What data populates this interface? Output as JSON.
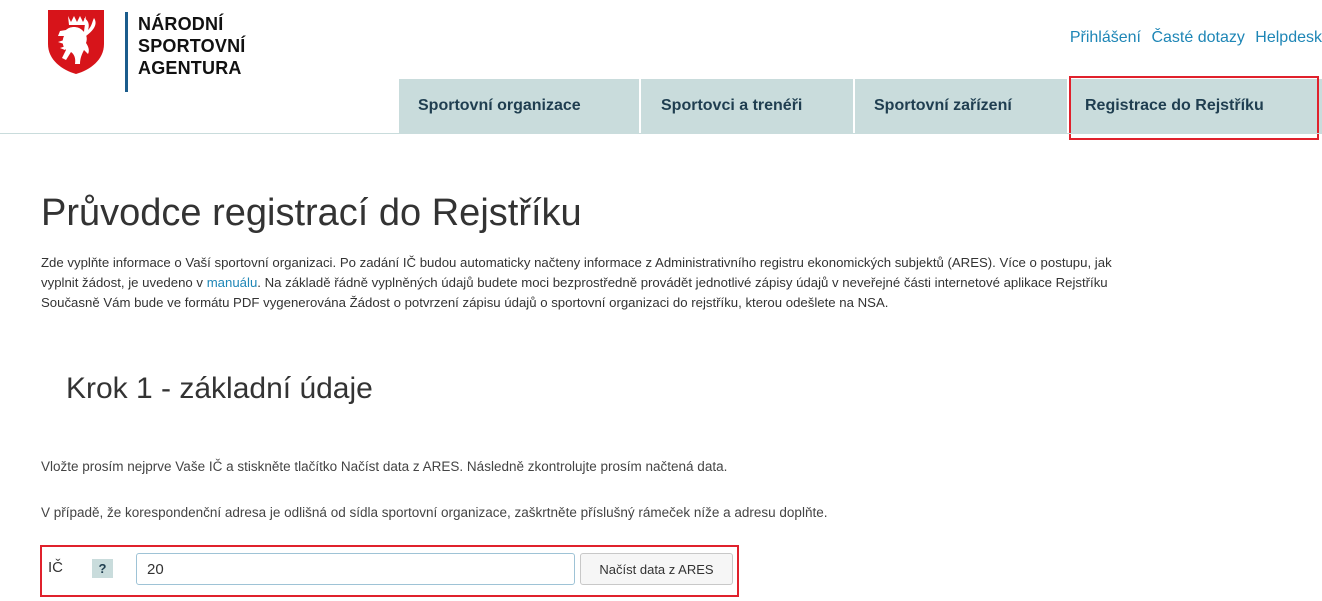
{
  "brand": {
    "line1": "NÁRODNÍ",
    "line2": "SPORTOVNÍ",
    "line3": "AGENTURA",
    "logo_icon": "czech-lion-coat-of-arms-icon"
  },
  "toplinks": {
    "login": "Přihlášení",
    "faq": "Časté dotazy",
    "helpdesk": "Helpdesk"
  },
  "nav": {
    "items": [
      {
        "label": "Sportovní organizace"
      },
      {
        "label": "Sportovci a trenéři"
      },
      {
        "label": "Sportovní zařízení"
      },
      {
        "label": "Registrace do Rejstříku",
        "highlighted": true
      }
    ]
  },
  "page": {
    "title": "Průvodce registrací do Rejstříku",
    "intro_line1": "Zde vyplňte informace o Vaší sportovní organizaci. Po zadání IČ budou automaticky načteny informace z Administrativního registru ekonomických subjektů (ARES). Více o postupu, jak",
    "intro_line2_pre": "vyplnit žádost, je uvedeno v ",
    "intro_line2_link": "manuálu",
    "intro_line2_post": ". Na základě řádně vyplněných údajů budete moci bezprostředně provádět jednotlivé zápisy údajů v neveřejné části internetové aplikace Rejstříku",
    "intro_line3": "Současně Vám bude ve formátu PDF vygenerována Žádost o potvrzení zápisu údajů o sportovní organizaci do rejstříku, kterou odešlete na NSA.",
    "step_title": "Krok 1 - základní údaje",
    "para1": "Vložte prosím nejprve Vaše IČ a stiskněte tlačítko Načíst data z ARES. Následně zkontrolujte prosím načtená data.",
    "para2": "V případě, že korespondenční adresa je odlišná od sídla sportovní organizace, zaškrtněte příslušný rámeček níže a adresu doplňte."
  },
  "form": {
    "ic_label": "IČ",
    "help_label": "?",
    "ic_value": "20",
    "load_button": "Načíst data z ARES"
  },
  "colors": {
    "nav_bg": "#c9dcdc",
    "link": "#1e86b6",
    "highlight": "#e0212c",
    "brand_red": "#d7141a"
  }
}
